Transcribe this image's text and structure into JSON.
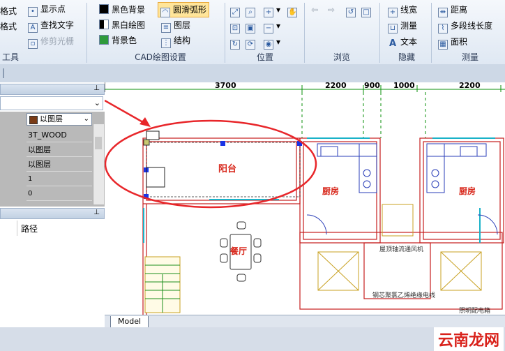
{
  "ribbon": {
    "left_partial": {
      "item1": "格式",
      "item2": "格式",
      "group": "工具"
    },
    "tools_group": {
      "show_points": "显示点",
      "find_text": "查找文字",
      "trim_grid": "修剪光栅"
    },
    "cad_settings": {
      "black_bg": "黑色背景",
      "bw_drawing": "黑白绘图",
      "bg_color": "背景色",
      "smooth_arc": "圆滑弧形",
      "layers": "图层",
      "structure": "结构",
      "group_label": "CAD绘图设置"
    },
    "position_group": "位置",
    "browse_group": "浏览",
    "hide_group": {
      "line_width": "线宽",
      "measure": "测量",
      "text": "文本",
      "group_label": "隐藏"
    },
    "measure_group": {
      "distance": "距离",
      "polyline_length": "多段线长度",
      "area": "面积",
      "group_label": "测量"
    }
  },
  "properties": {
    "color_value": "以图层",
    "rows": [
      "3T_WOOD",
      "以图层",
      "以图层",
      "1",
      "0"
    ]
  },
  "layout_panel": {
    "path_header": "路径"
  },
  "drawing": {
    "dims": [
      "3700",
      "2200",
      "900",
      "1000",
      "2200"
    ],
    "rooms": {
      "balcony": "阳台",
      "kitchen1": "厨房",
      "kitchen2": "厨房",
      "dining": "餐厅"
    },
    "notes": [
      "屋顶轴流通风机",
      "钢芯聚氯乙烯绝缘电线",
      "照明配电箱"
    ]
  },
  "tabs": {
    "model": "Model"
  },
  "watermark": "云南龙网"
}
